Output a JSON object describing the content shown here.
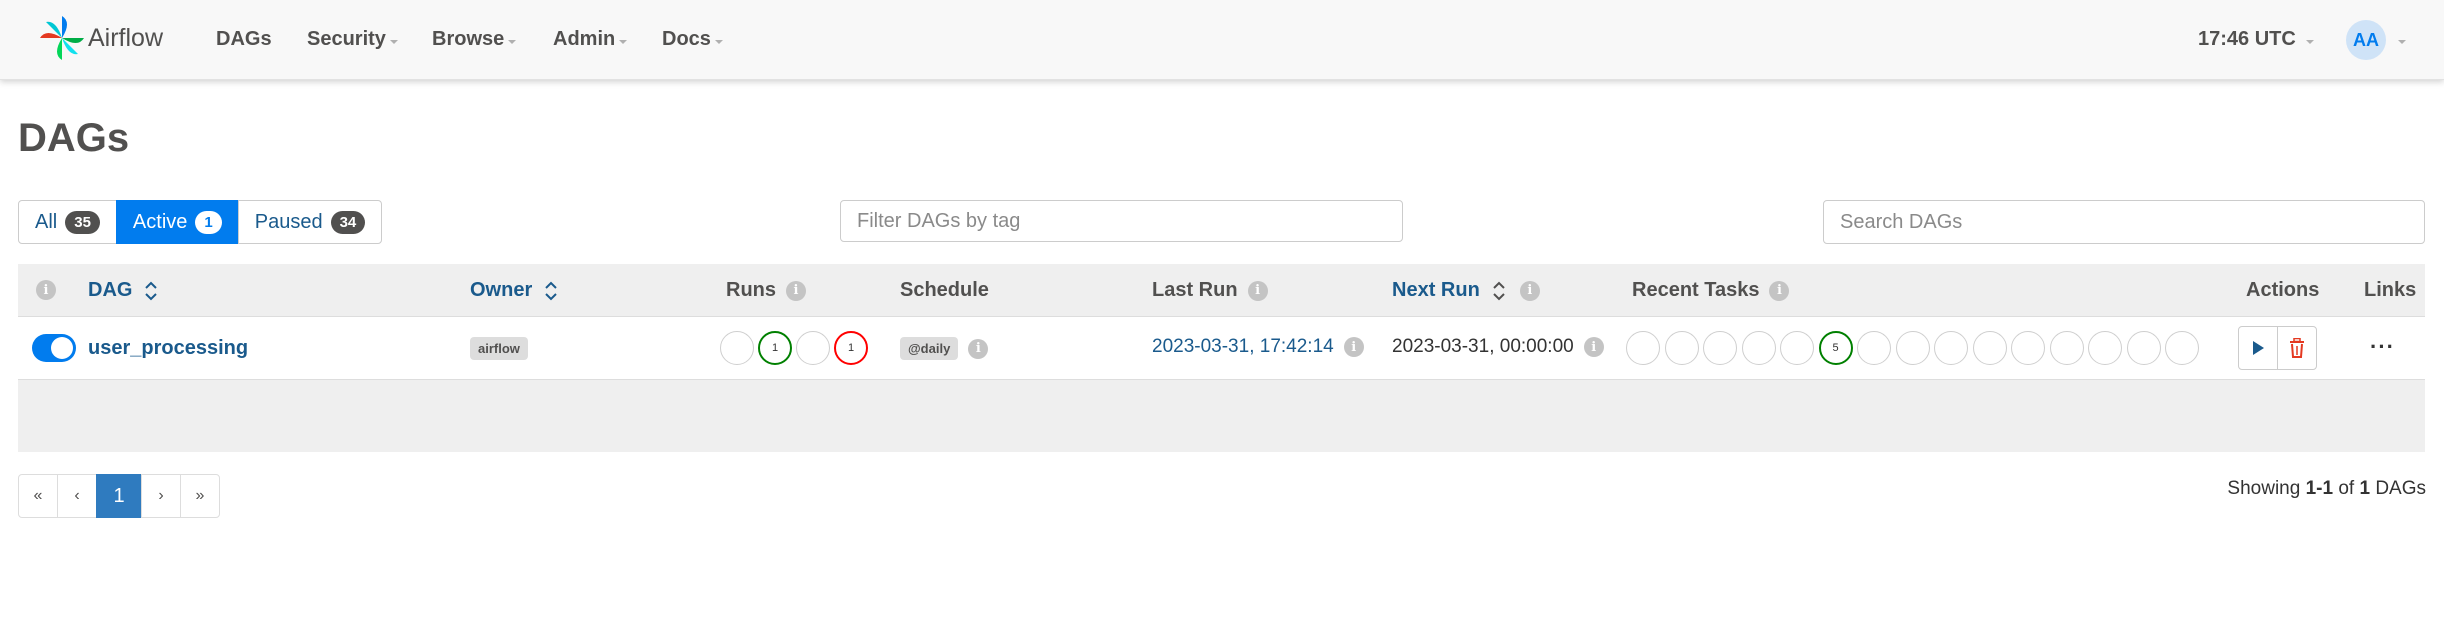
{
  "navbar": {
    "brand": "Airflow",
    "items": [
      {
        "label": "DAGs",
        "dropdown": false
      },
      {
        "label": "Security",
        "dropdown": true
      },
      {
        "label": "Browse",
        "dropdown": true
      },
      {
        "label": "Admin",
        "dropdown": true
      },
      {
        "label": "Docs",
        "dropdown": true
      }
    ],
    "clock": "17:46 UTC",
    "user_initials": "AA"
  },
  "page": {
    "title": "DAGs"
  },
  "status_filter": {
    "all": {
      "label": "All",
      "count": "35"
    },
    "active": {
      "label": "Active",
      "count": "1"
    },
    "paused": {
      "label": "Paused",
      "count": "34"
    },
    "selected": "Active"
  },
  "tag_filter": {
    "placeholder": "Filter DAGs by tag",
    "value": ""
  },
  "search": {
    "placeholder": "Search DAGs",
    "value": ""
  },
  "table": {
    "headers": {
      "dag": "DAG",
      "owner": "Owner",
      "runs": "Runs",
      "schedule": "Schedule",
      "last_run": "Last Run",
      "next_run": "Next Run",
      "recent_tasks": "Recent Tasks",
      "actions": "Actions",
      "links": "Links"
    },
    "rows": [
      {
        "active": true,
        "dag_id": "user_processing",
        "owner": "airflow",
        "runs": [
          {
            "state": "none",
            "count": ""
          },
          {
            "state": "success",
            "count": "1"
          },
          {
            "state": "none",
            "count": ""
          },
          {
            "state": "failed",
            "count": "1"
          }
        ],
        "schedule": "@daily",
        "last_run": "2023-03-31, 17:42:14",
        "next_run": "2023-03-31, 00:00:00",
        "recent_tasks": [
          {
            "state": "none",
            "count": ""
          },
          {
            "state": "none",
            "count": ""
          },
          {
            "state": "none",
            "count": ""
          },
          {
            "state": "none",
            "count": ""
          },
          {
            "state": "none",
            "count": ""
          },
          {
            "state": "success",
            "count": "5"
          },
          {
            "state": "none",
            "count": ""
          },
          {
            "state": "none",
            "count": ""
          },
          {
            "state": "none",
            "count": ""
          },
          {
            "state": "none",
            "count": ""
          },
          {
            "state": "none",
            "count": ""
          },
          {
            "state": "none",
            "count": ""
          },
          {
            "state": "none",
            "count": ""
          },
          {
            "state": "none",
            "count": ""
          },
          {
            "state": "none",
            "count": ""
          }
        ],
        "links_icon": "more-icon",
        "links_label": "···"
      }
    ]
  },
  "pagination": {
    "first": "«",
    "prev": "‹",
    "current": "1",
    "next": "›",
    "last": "»"
  },
  "summary": {
    "prefix": "Showing ",
    "range": "1-1",
    "middle": " of ",
    "total": "1",
    "suffix": " DAGs"
  },
  "colors": {
    "accent": "#017cee",
    "link": "#1a5a8c",
    "success": "#008000",
    "failed": "#ff0000",
    "delete": "#e43921"
  }
}
